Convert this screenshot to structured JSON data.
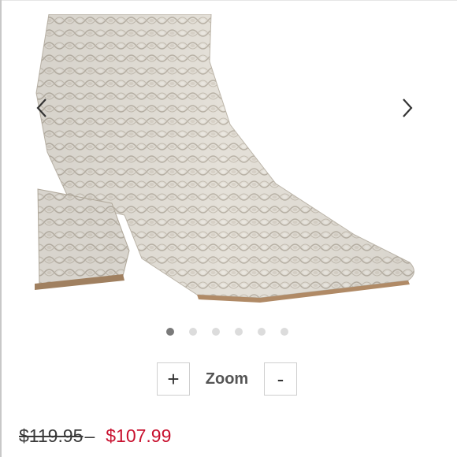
{
  "gallery": {
    "prev_icon": "chevron-left-icon",
    "next_icon": "chevron-right-icon",
    "dot_count": 6,
    "active_dot": 0
  },
  "zoom": {
    "plus_label": "+",
    "label": "Zoom",
    "minus_label": "-"
  },
  "price": {
    "original": "$119.95",
    "sale": "$107.99",
    "sale_color": "#c8102e"
  }
}
